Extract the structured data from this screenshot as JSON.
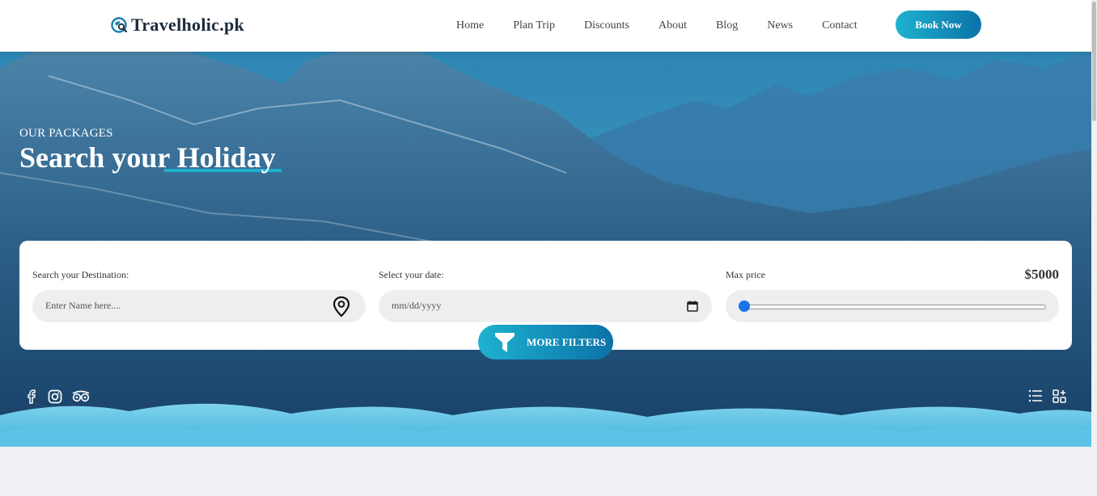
{
  "header": {
    "logo_text": "Travelholic.pk",
    "nav": [
      "Home",
      "Plan Trip",
      "Discounts",
      "About",
      "Blog",
      "News",
      "Contact"
    ],
    "book_label": "Book Now"
  },
  "hero": {
    "eyebrow": "OUR PACKAGES",
    "title": "Search your Holiday"
  },
  "search": {
    "destination_label": "Search your Destination:",
    "destination_placeholder": "Enter Name here....",
    "date_label": "Select your date:",
    "date_placeholder": "mm/dd/yyyy",
    "price_label": "Max price",
    "price_value": "$5000",
    "price_slider_fraction": 0
  },
  "filters_label": "MORE FILTERS",
  "socials": [
    "facebook-icon",
    "instagram-icon",
    "tripadvisor-icon"
  ],
  "view_icons": [
    "list-view-icon",
    "grid-view-icon"
  ],
  "colors": {
    "accent_start": "#1eb2cf",
    "accent_end": "#0b72a8",
    "slider_thumb": "#1a73e8"
  }
}
